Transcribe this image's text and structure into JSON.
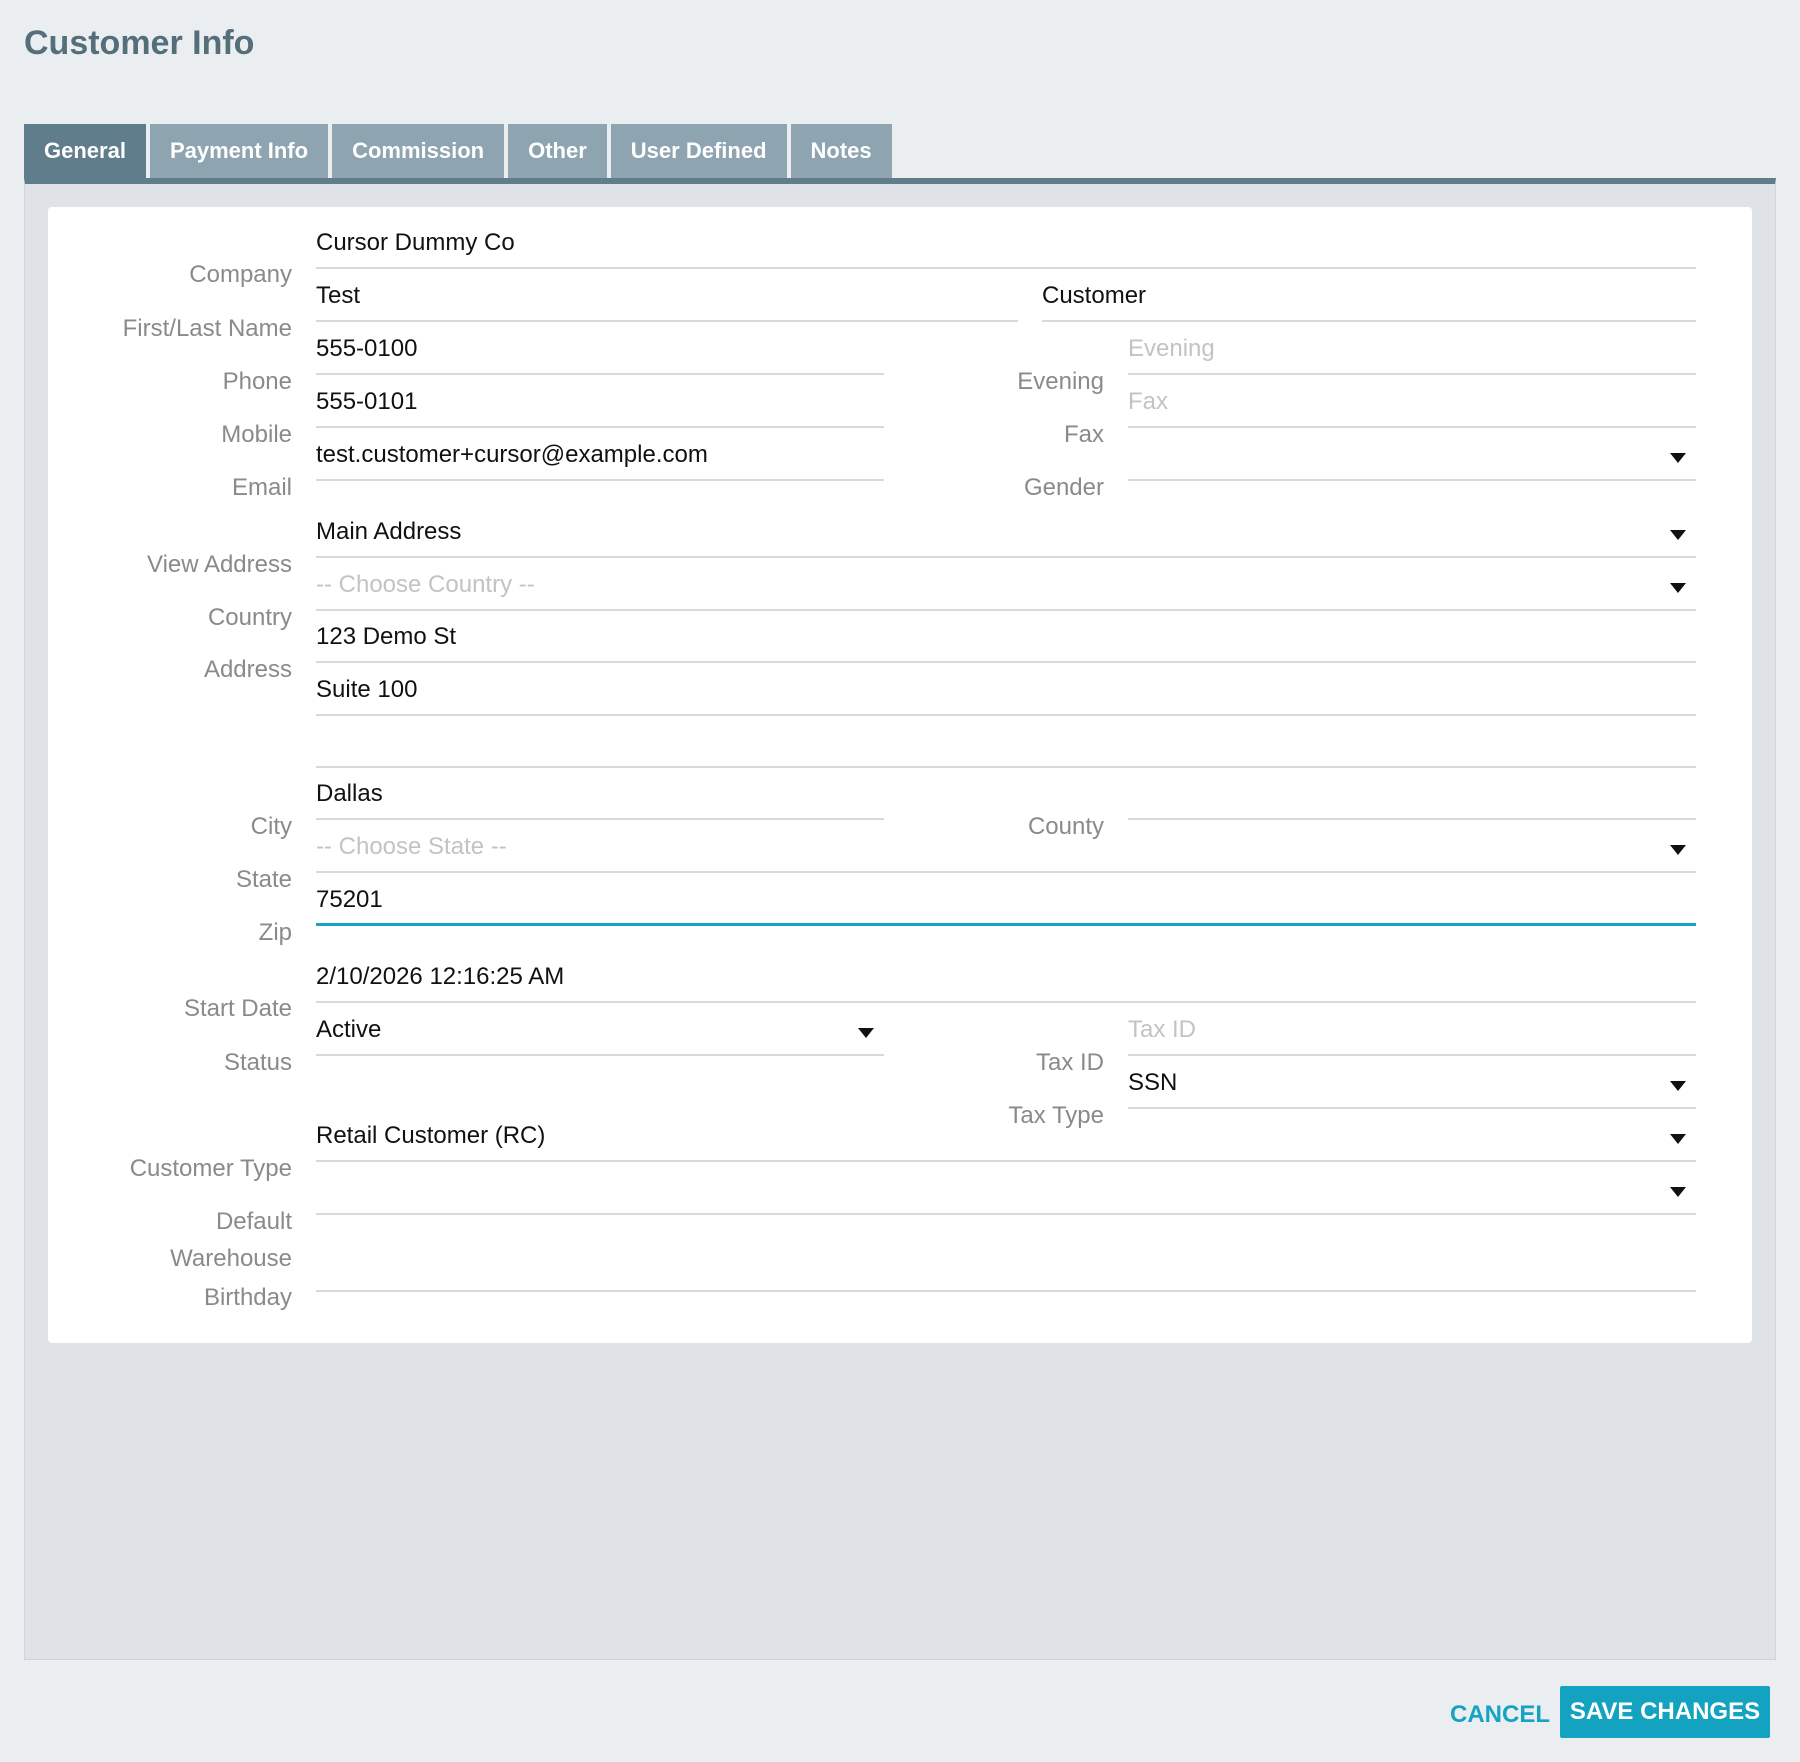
{
  "page": {
    "title": "Customer Info"
  },
  "tabs": [
    "General",
    "Payment Info",
    "Commission",
    "Other",
    "User Defined",
    "Notes"
  ],
  "labels": {
    "company": "Company",
    "name": "First/Last Name",
    "phone": "Phone",
    "evening": "Evening",
    "mobile": "Mobile",
    "fax": "Fax",
    "email": "Email",
    "gender": "Gender",
    "view_address": "View Address",
    "country": "Country",
    "address": "Address",
    "city": "City",
    "county": "County",
    "state": "State",
    "zip": "Zip",
    "start_date": "Start Date",
    "status": "Status",
    "tax_id": "Tax ID",
    "tax_type": "Tax Type",
    "customer_type": "Customer Type",
    "default_warehouse_1": "Default",
    "default_warehouse_2": "Warehouse",
    "birthday": "Birthday"
  },
  "values": {
    "company": "Cursor Dummy Co",
    "first_name": "Test",
    "last_name": "Customer",
    "phone": "555-0100",
    "evening": "",
    "mobile": "555-0101",
    "fax": "",
    "email": "test.customer+cursor@example.com",
    "gender": "",
    "view_address": "Main Address",
    "country": "",
    "address1": "123 Demo St",
    "address2": "Suite 100",
    "address3": "",
    "city": "Dallas",
    "county": "",
    "state": "",
    "zip": "75201",
    "start_date": "2/10/2026 12:16:25 AM",
    "status": "Active",
    "tax_id": "",
    "tax_type": "SSN",
    "customer_type": "Retail Customer (RC)",
    "default_warehouse": "",
    "birthday": ""
  },
  "placeholders": {
    "evening": "Evening",
    "fax": "Fax",
    "country": "-- Choose Country --",
    "state": "-- Choose State --",
    "tax_id": "Tax ID"
  },
  "actions": {
    "cancel": "CANCEL",
    "save": "SAVE CHANGES"
  },
  "colors": {
    "accent": "#13a2c0",
    "tab_active": "#607d8b",
    "tab_inactive": "#8fa4b1"
  }
}
